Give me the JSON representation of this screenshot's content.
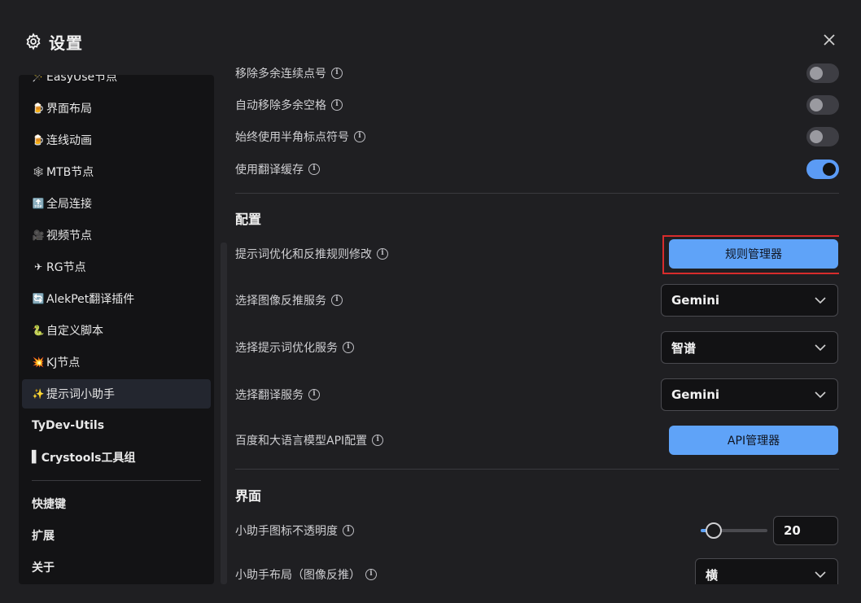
{
  "header": {
    "title": "设置",
    "icon": "gear-icon"
  },
  "sidebar": {
    "items": [
      {
        "emoji": "🪄",
        "label": "EasyUse节点"
      },
      {
        "emoji": "🍺",
        "label": "界面布局"
      },
      {
        "emoji": "🍺",
        "label": "连线动画"
      },
      {
        "emoji": "🕸",
        "label": "MTB节点"
      },
      {
        "emoji": "🔝",
        "label": "全局连接"
      },
      {
        "emoji": "🎥",
        "label": "视频节点"
      },
      {
        "emoji": "✈",
        "label": "RG节点"
      },
      {
        "emoji": "🔄",
        "label": "AlekPet翻译插件"
      },
      {
        "emoji": "🐍",
        "label": "自定义脚本"
      },
      {
        "emoji": "💥",
        "label": "KJ节点"
      },
      {
        "emoji": "✨",
        "label": "提示词小助手"
      },
      {
        "emoji": "",
        "label": "TyDev-Utils"
      },
      {
        "emoji": "▌",
        "label": "Crystools工具组"
      }
    ],
    "footer_items": [
      {
        "label": "快捷键"
      },
      {
        "label": "扩展"
      },
      {
        "label": "关于"
      }
    ],
    "active_index": 10
  },
  "content": {
    "toggles": [
      {
        "label": "移除多余连续点号",
        "on": false
      },
      {
        "label": "自动移除多余空格",
        "on": false
      },
      {
        "label": "始终使用半角标点符号",
        "on": false
      },
      {
        "label": "使用翻译缓存",
        "on": true
      }
    ],
    "section_config": "配置",
    "rules": {
      "label": "提示词优化和反推规则修改",
      "button": "规则管理器"
    },
    "image_service": {
      "label": "选择图像反推服务",
      "value": "Gemini"
    },
    "prompt_service": {
      "label": "选择提示词优化服务",
      "value": "智谱"
    },
    "translate_service": {
      "label": "选择翻译服务",
      "value": "Gemini"
    },
    "api": {
      "label": "百度和大语言模型API配置",
      "button": "API管理器"
    },
    "section_ui": "界面",
    "opacity": {
      "label": "小助手图标不透明度",
      "value": "20",
      "fraction": 0.2
    },
    "layout": {
      "label": "小助手布局（图像反推）",
      "value": "横"
    }
  },
  "colors": {
    "accent": "#5fa3f8",
    "highlight": "#d72c2c",
    "toggle_on": "#5b9bf5"
  }
}
